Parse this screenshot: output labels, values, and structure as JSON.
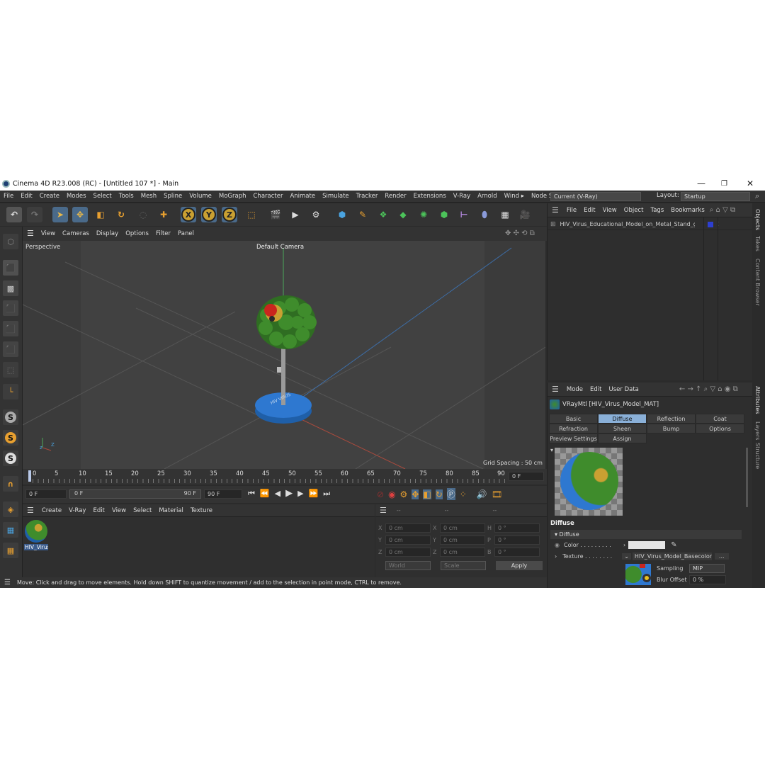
{
  "window": {
    "title": "Cinema 4D R23.008 (RC) - [Untitled 107 *] - Main",
    "minimize": "—",
    "restore": "❐",
    "close": "✕"
  },
  "menu": [
    "File",
    "Edit",
    "Create",
    "Modes",
    "Select",
    "Tools",
    "Mesh",
    "Spline",
    "Volume",
    "MoGraph",
    "Character",
    "Animate",
    "Simulate",
    "Tracker",
    "Render",
    "Extensions",
    "V-Ray",
    "Arnold",
    "Wind ▸"
  ],
  "node_space": {
    "label": "Node Space:",
    "value": "Current (V-Ray)"
  },
  "layout": {
    "label": "Layout:",
    "value": "Startup"
  },
  "viewport": {
    "menu": [
      "View",
      "Cameras",
      "Display",
      "Options",
      "Filter",
      "Panel"
    ],
    "label": "Perspective",
    "camera": "Default Camera",
    "grid": "Grid Spacing : 50 cm"
  },
  "timeline": {
    "ticks": [
      "0",
      "5",
      "10",
      "15",
      "20",
      "25",
      "30",
      "35",
      "40",
      "45",
      "50",
      "55",
      "60",
      "65",
      "70",
      "75",
      "80",
      "85",
      "90"
    ],
    "frame": "0 F"
  },
  "playback": {
    "start": "0 F",
    "range_start": "0 F",
    "range_end": "90 F",
    "end": "90 F"
  },
  "matmgr": {
    "menu": [
      "Create",
      "V-Ray",
      "Edit",
      "View",
      "Select",
      "Material",
      "Texture"
    ],
    "material": "HIV_Virus"
  },
  "coords": {
    "header": [
      "--",
      "--",
      "--"
    ],
    "x": "X",
    "y": "Y",
    "z": "Z",
    "val": "0 cm",
    "h": "H",
    "p": "P",
    "b": "B",
    "deg": "0 °",
    "world": "World",
    "scale": "Scale",
    "apply": "Apply"
  },
  "status": "Move: Click and drag to move elements. Hold down SHIFT to quantize movement / add to the selection in point mode, CTRL to remove.",
  "objmgr": {
    "menu": [
      "File",
      "Edit",
      "View",
      "Object",
      "Tags",
      "Bookmarks"
    ],
    "object": "HIV_Virus_Educational_Model_on_Metal_Stand_g"
  },
  "attr": {
    "menu": [
      "Mode",
      "Edit",
      "User Data"
    ],
    "material": "VRayMtl [HIV_Virus_Model_MAT]",
    "tabs": [
      "Basic",
      "Diffuse",
      "Reflection",
      "Coat",
      "Refraction",
      "Sheen",
      "Bump",
      "Options",
      "Preview Settings",
      "Assign"
    ],
    "section": "Diffuse",
    "group": "▾ Diffuse",
    "color_label": "Color . . . . . . . . .",
    "texture_label": "Texture . . . . . . . .",
    "texture_value": "HIV_Virus_Model_Basecolor.",
    "texture_btn": "...",
    "sampling_label": "Sampling",
    "sampling_value": "MIP",
    "blur_label": "Blur Offset",
    "blur_value": "0 %"
  },
  "sidetabs": [
    "Objects",
    "Takes",
    "Content Browser",
    "Attributes",
    "Layers",
    "Structure"
  ]
}
